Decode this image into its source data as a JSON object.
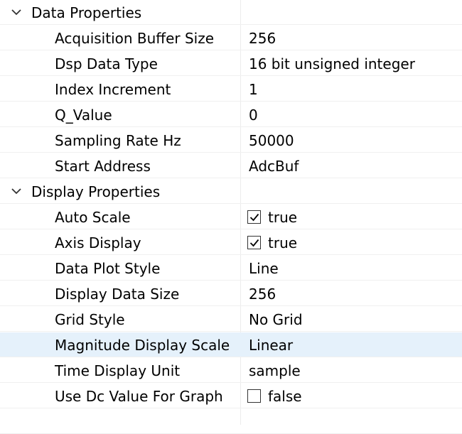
{
  "groups": [
    {
      "label": "Data Properties",
      "expanded": true,
      "properties": [
        {
          "name": "Acquisition Buffer Size",
          "value": "256",
          "type": "text"
        },
        {
          "name": "Dsp Data Type",
          "value": "16 bit unsigned integer",
          "type": "text"
        },
        {
          "name": "Index Increment",
          "value": "1",
          "type": "text"
        },
        {
          "name": "Q_Value",
          "value": "0",
          "type": "text"
        },
        {
          "name": "Sampling Rate Hz",
          "value": "50000",
          "type": "text"
        },
        {
          "name": "Start Address",
          "value": "AdcBuf",
          "type": "text"
        }
      ]
    },
    {
      "label": "Display Properties",
      "expanded": true,
      "properties": [
        {
          "name": "Auto Scale",
          "value": "true",
          "type": "checkbox",
          "checked": true
        },
        {
          "name": "Axis Display",
          "value": "true",
          "type": "checkbox",
          "checked": true
        },
        {
          "name": "Data Plot Style",
          "value": "Line",
          "type": "text"
        },
        {
          "name": "Display Data Size",
          "value": "256",
          "type": "text"
        },
        {
          "name": "Grid Style",
          "value": "No Grid",
          "type": "text"
        },
        {
          "name": "Magnitude Display Scale",
          "value": "Linear",
          "type": "text",
          "selected": true
        },
        {
          "name": "Time Display Unit",
          "value": "sample",
          "type": "text"
        },
        {
          "name": "Use Dc Value For Graph",
          "value": "false",
          "type": "checkbox",
          "checked": false
        }
      ]
    }
  ],
  "colors": {
    "selected_row": "#e5f1fb",
    "grid_line": "#f0f0f0",
    "divider": "#ececec",
    "text": "#000000"
  },
  "icons": {
    "group_toggle": "chevron-down-icon",
    "checked": "checkbox-checked-icon",
    "unchecked": "checkbox-unchecked-icon"
  }
}
